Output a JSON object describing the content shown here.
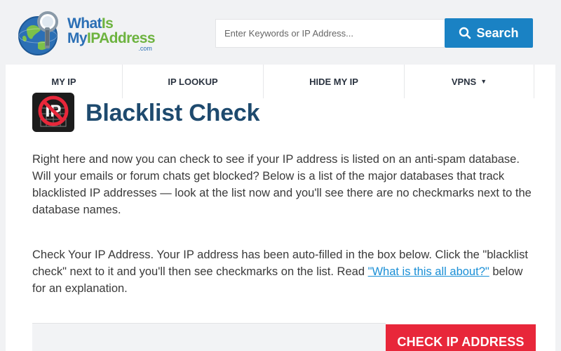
{
  "logo": {
    "line1_a": "What",
    "line1_b": "Is",
    "line2_a": "My",
    "line2_b": "IPAddress",
    "suffix": ".com"
  },
  "search": {
    "placeholder": "Enter Keywords or IP Address...",
    "button_label": "Search"
  },
  "nav": [
    {
      "label": "MY IP"
    },
    {
      "label": "IP LOOKUP"
    },
    {
      "label": "HIDE MY IP"
    },
    {
      "label": "VPNS",
      "caret": "▼"
    }
  ],
  "page": {
    "title": "Blacklist Check",
    "icon_text": "IP",
    "para1": "Right here and now you can check to see if your IP address is listed on an anti-spam database. Will your emails or forum chats get blocked? Below is a list of the major databases that track blacklisted IP addresses — look at the list now and you'll see there are no checkmarks next to the database names.",
    "para2_text": "Check Your IP Address. Your IP address has been auto-filled in the box below. Click the \"blacklist check\" next to it and you'll then see checkmarks on the list. Read ",
    "para2_link": "\"What is this all about?\"",
    "para2_tail": " below for an explanation."
  },
  "check_button": "CHECK IP ADDRESS",
  "colors": {
    "brand_blue": "#2b6fb5",
    "brand_green": "#6db33f",
    "search_button": "#1a82c4",
    "title": "#1e4a6e",
    "check_button": "#e8273a",
    "link": "#1a8fd6"
  }
}
